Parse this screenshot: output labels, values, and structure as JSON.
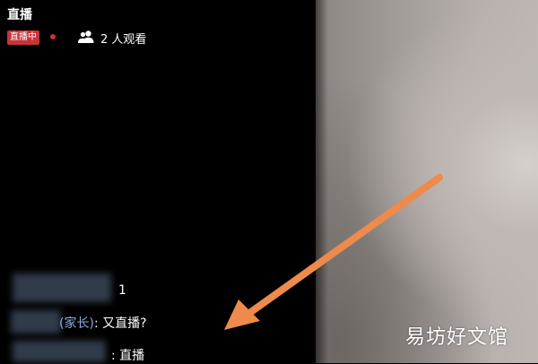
{
  "header": {
    "title": "直播",
    "live_badge": "直播中",
    "viewers": "2 人观看",
    "viewers_icon": "users-icon"
  },
  "chat": {
    "messages": [
      {
        "text": "1"
      },
      {
        "name_tail": "(家长)",
        "text": ": 又直播?"
      },
      {
        "text": ": 直播"
      }
    ]
  },
  "watermark": "易坊好文馆",
  "colors": {
    "live_red": "#c8343a",
    "arrow_orange": "#ee8a4c",
    "chat_name_blue": "#8fa7e6"
  }
}
